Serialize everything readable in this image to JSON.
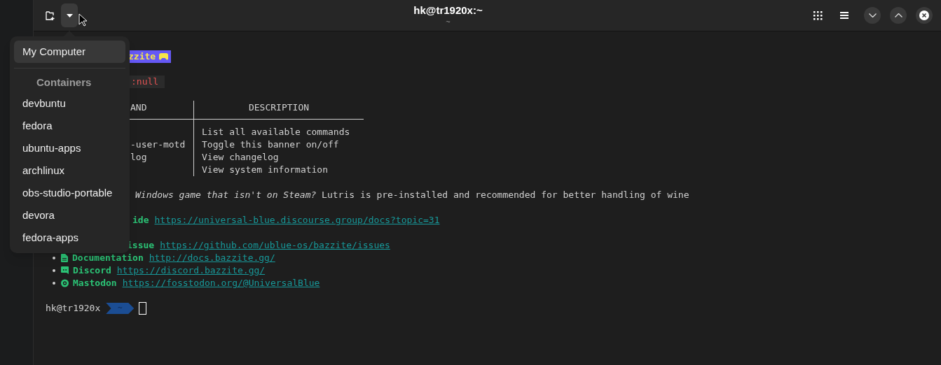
{
  "header": {
    "title": "hk@tr1920x:~",
    "subtitle": "~"
  },
  "menu": {
    "items": [
      {
        "label": "My Computer",
        "selected": true
      }
    ],
    "section": "Containers",
    "containers": [
      {
        "label": "devbuntu",
        "selected": false
      },
      {
        "label": "fedora",
        "selected": false
      },
      {
        "label": "ubuntu-apps",
        "selected": false
      },
      {
        "label": "archlinux",
        "selected": false
      },
      {
        "label": "obs-studio-portable",
        "selected": false
      },
      {
        "label": "devora",
        "selected": false
      },
      {
        "label": "fedora-apps",
        "selected": false
      }
    ]
  },
  "terminal": {
    "banner": "zzite",
    "error": ":null",
    "table": {
      "columns": [
        "AND",
        "DESCRIPTION"
      ],
      "rows": [
        {
          "description": "List all available commands"
        },
        {
          "command": "-user-motd",
          "description": "Toggle this banner on/off"
        },
        {
          "command": "log",
          "description": "View changelog"
        },
        {
          "description": "View system information"
        }
      ]
    },
    "tip": {
      "italic": "Windows game that isn't on Steam?",
      "rest": "Lutris is pre-installed and recommended for better handling of wine"
    },
    "links": [
      {
        "label": "ide",
        "url": "https://universal-blue.discourse.group/docs?topic=31"
      },
      {
        "label": "issue",
        "url": "https://github.com/ublue-os/bazzite/issues"
      }
    ],
    "bullets": [
      {
        "kind": "document",
        "label": "Documentation",
        "url": "http://docs.bazzite.gg/"
      },
      {
        "kind": "chat",
        "label": "Discord",
        "url": "https://discord.bazzite.gg/"
      },
      {
        "kind": "at",
        "label": "Mastodon",
        "url": "https://fosstodon.org/@UniversalBlue"
      }
    ],
    "prompt": {
      "user": "hk@tr1920x",
      "dir": "~"
    }
  }
}
